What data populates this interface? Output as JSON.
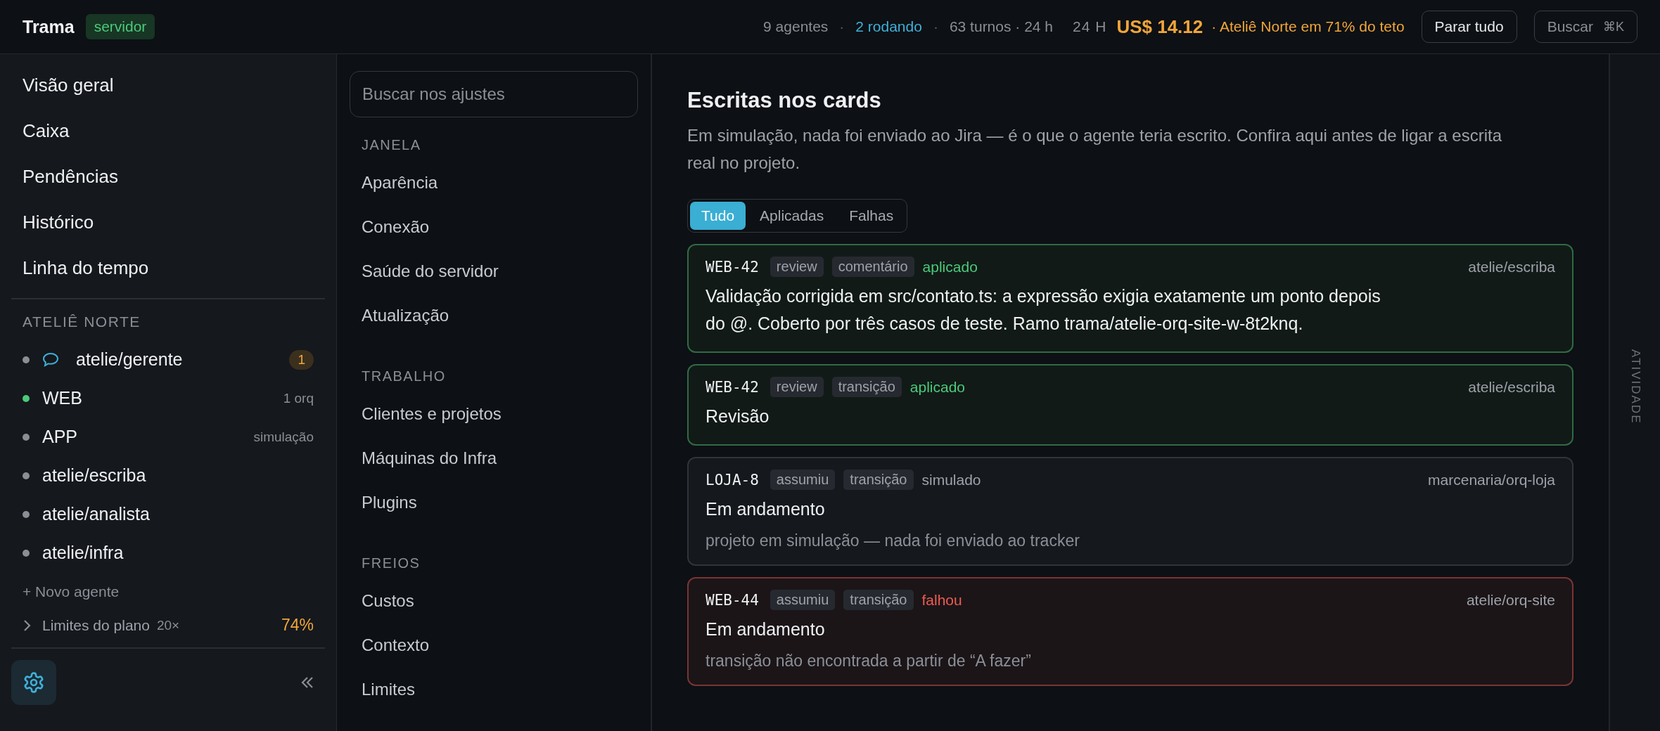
{
  "topbar": {
    "app_name": "Trama",
    "badge": "servidor",
    "separator": "·",
    "stats": [
      {
        "text": "9 agentes",
        "kind": "plain"
      },
      {
        "text": "2 rodando",
        "kind": "active"
      },
      {
        "text": "63 turnos · 24 h",
        "kind": "plain"
      }
    ],
    "spend": {
      "period": "24 H",
      "amount": "US$ 14.12",
      "warning": "· Ateliê Norte em 71% do teto"
    },
    "buttons": [
      {
        "label": "Parar tudo"
      },
      {
        "label": "Buscar",
        "shortcut": "⌘K"
      }
    ]
  },
  "sidebar": {
    "nav": [
      {
        "label": "Visão geral"
      },
      {
        "label": "Caixa"
      },
      {
        "label": "Pendências"
      },
      {
        "label": "Histórico"
      },
      {
        "label": "Linha do tempo"
      }
    ],
    "group": {
      "title": "ATELIÊ NORTE",
      "agents": [
        {
          "name": "atelie/gerente",
          "color": "#8b8e94",
          "chat": true,
          "badge": "1"
        },
        {
          "name": "WEB",
          "color": "#4cc97a",
          "meta": "1 orq"
        },
        {
          "name": "APP",
          "color": "#8b8e94",
          "meta": "simulação"
        },
        {
          "name": "atelie/escriba",
          "color": "#8b8e94"
        },
        {
          "name": "atelie/analista",
          "color": "#8b8e94"
        },
        {
          "name": "atelie/infra",
          "color": "#8b8e94"
        }
      ]
    },
    "new_agent": "+ Novo agente",
    "plan_limits": {
      "label": "Limites do plano",
      "multiplier": "20×",
      "percent": "74%",
      "expanded": false
    }
  },
  "settings_nav": {
    "search": {
      "placeholder": "Buscar nos ajustes"
    },
    "sections": [
      {
        "title": "JANELA",
        "items": [
          "Aparência",
          "Conexão",
          "Saúde do servidor",
          "Atualização"
        ]
      },
      {
        "title": "TRABALHO",
        "items": [
          "Clientes e projetos",
          "Máquinas do Infra",
          "Plugins"
        ]
      },
      {
        "title": "FREIOS",
        "items": [
          "Custos",
          "Contexto",
          "Limites"
        ]
      }
    ]
  },
  "main": {
    "title": "Escritas nos cards",
    "description": "Em simulação, nada foi enviado ao Jira — é o que o agente teria escrito. Confira aqui antes de ligar a escrita real no projeto.",
    "filters": [
      {
        "label": "Tudo",
        "selected": true
      },
      {
        "label": "Aplicadas",
        "selected": false
      },
      {
        "label": "Falhas",
        "selected": false
      }
    ],
    "cards": [
      {
        "kind": "applied",
        "key": "WEB-42",
        "tags": [
          "review",
          "comentário"
        ],
        "status": "aplicado",
        "agent": "atelie/escriba",
        "body": "Validação corrigida em src/contato.ts: a expressão exigia exatamente um ponto depois do @. Coberto por três casos de teste. Ramo trama/atelie-orq-site-w-8t2knq."
      },
      {
        "kind": "applied",
        "key": "WEB-42",
        "tags": [
          "review",
          "transição"
        ],
        "status": "aplicado",
        "agent": "atelie/escriba",
        "body": "Revisão"
      },
      {
        "kind": "simulated",
        "key": "LOJA-8",
        "tags": [
          "assumiu",
          "transição"
        ],
        "status": "simulado",
        "agent": "marcenaria/orq-loja",
        "body": "Em andamento",
        "note": "projeto em simulação — nada foi enviado ao tracker"
      },
      {
        "kind": "failed",
        "key": "WEB-44",
        "tags": [
          "assumiu",
          "transição"
        ],
        "status": "falhou",
        "agent": "atelie/orq-site",
        "body": "Em andamento",
        "note": "transição não encontrada a partir de “A fazer”"
      }
    ]
  },
  "activity_rail": {
    "label": "ATIVIDADE"
  }
}
